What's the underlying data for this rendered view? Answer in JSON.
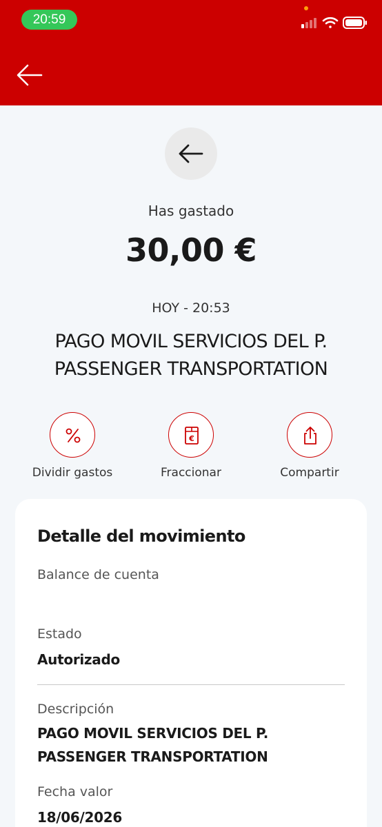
{
  "status_bar": {
    "time": "20:59"
  },
  "summary": {
    "spent_label": "Has gastado",
    "amount": "30,00 €",
    "datetime": "HOY - 20:53",
    "merchant_line1": "PAGO MOVIL SERVICIOS DEL P.",
    "merchant_line2": "PASSENGER TRANSPORTATION"
  },
  "actions": [
    {
      "label": "Dividir gastos",
      "icon": "percent-icon"
    },
    {
      "label": "Fraccionar",
      "icon": "euro-receipt-icon"
    },
    {
      "label": "Compartir",
      "icon": "share-icon"
    }
  ],
  "detail": {
    "title": "Detalle del movimiento",
    "balance_label": "Balance de cuenta",
    "status_label": "Estado",
    "status_value": "Autorizado",
    "description_label": "Descripción",
    "description_line1": "PAGO MOVIL SERVICIOS DEL P.",
    "description_line2": "PASSENGER TRANSPORTATION",
    "value_date_label": "Fecha valor",
    "value_date": "18/06/2026"
  },
  "colors": {
    "brand_red": "#cc0000",
    "status_green": "#34c759",
    "background": "#f4f7fa"
  }
}
